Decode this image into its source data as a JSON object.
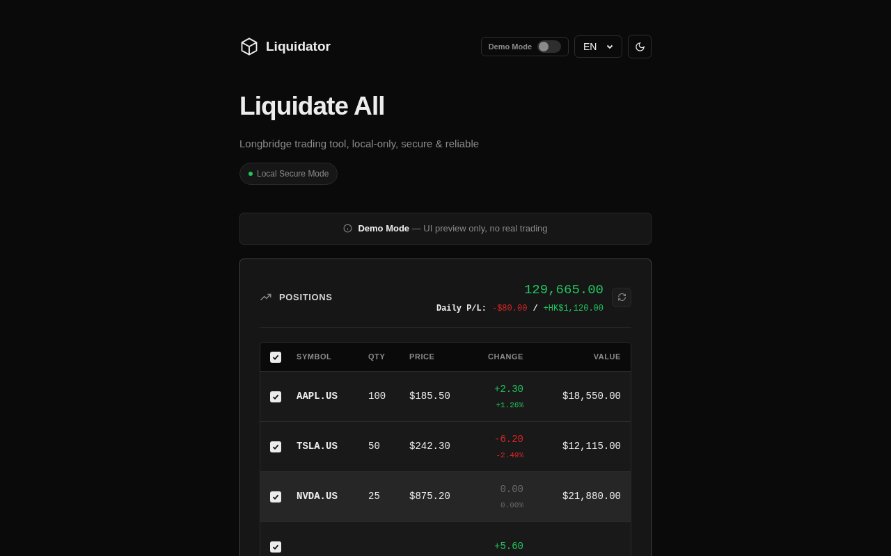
{
  "brand": {
    "name": "Liquidator"
  },
  "header": {
    "demo_toggle": {
      "label": "Demo Mode",
      "on": false
    },
    "language": {
      "value": "EN"
    }
  },
  "hero": {
    "title": "Liquidate All",
    "subtitle": "Longbridge trading tool, local-only, secure & reliable",
    "badge": {
      "label": "Local Secure Mode",
      "color": "#22c55e"
    }
  },
  "notice": {
    "text": "**Demo Mode** — UI preview only, no real trading"
  },
  "positions": {
    "title": "POSITIONS",
    "total": "129,665.00",
    "daily_label": "Daily P/L:",
    "daily_usd": "-$80.00",
    "separator": "/",
    "daily_hkd": "+HK$1,120.00",
    "table": {
      "all_checked": true,
      "columns": [
        "SYMBOL",
        "QTY",
        "PRICE",
        "CHANGE",
        "VALUE"
      ],
      "rows": [
        {
          "checked": true,
          "highlighted": false,
          "symbol": "AAPL.US",
          "qty": "100",
          "price": "$185.50",
          "color": "#22c55e",
          "change": "+2.30",
          "change_pct": "+1.26%",
          "value": "$18,550.00"
        },
        {
          "checked": true,
          "highlighted": false,
          "symbol": "TSLA.US",
          "qty": "50",
          "price": "$242.30",
          "color": "#dc2626",
          "change": "-6.20",
          "change_pct": "-2.49%",
          "value": "$12,115.00"
        },
        {
          "checked": true,
          "highlighted": true,
          "symbol": "NVDA.US",
          "qty": "25",
          "price": "$875.20",
          "color": "#6b6b6b",
          "change": "0.00",
          "change_pct": "0.00%",
          "value": "$21,880.00"
        },
        {
          "checked": true,
          "highlighted": false,
          "color": "#22c55e",
          "change": "+5.60"
        }
      ]
    }
  }
}
